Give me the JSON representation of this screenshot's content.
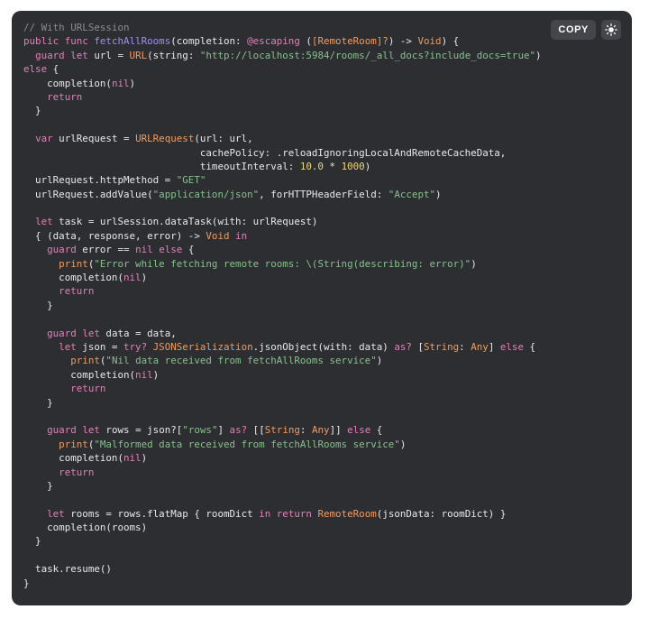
{
  "toolbar": {
    "copy_label": "COPY",
    "theme_icon": "sun-icon"
  },
  "colors": {
    "background": "#2d2e32",
    "comment": "#8a8c93",
    "keyword": "#e37fb8",
    "type": "#f29b5a",
    "function": "#9d8ef2",
    "string": "#86c08a",
    "number": "#ead675",
    "plain": "#e8e8ea"
  },
  "code": {
    "language": "swift",
    "lines": [
      [
        [
          "comment",
          "// With URLSession"
        ]
      ],
      [
        [
          "keyword",
          "public"
        ],
        [
          "plain",
          " "
        ],
        [
          "keyword",
          "func"
        ],
        [
          "plain",
          " "
        ],
        [
          "func",
          "fetchAllRooms"
        ],
        [
          "plain",
          "(completion: "
        ],
        [
          "keyword",
          "@escaping"
        ],
        [
          "plain",
          " ("
        ],
        [
          "type",
          "[RemoteRoom]?"
        ],
        [
          "plain",
          ") -> "
        ],
        [
          "type",
          "Void"
        ],
        [
          "plain",
          ") {"
        ]
      ],
      [
        [
          "plain",
          "  "
        ],
        [
          "keyword",
          "guard"
        ],
        [
          "plain",
          " "
        ],
        [
          "keyword",
          "let"
        ],
        [
          "plain",
          " url = "
        ],
        [
          "type",
          "URL"
        ],
        [
          "plain",
          "(string: "
        ],
        [
          "string",
          "\"http://localhost:5984/rooms/_all_docs?include_docs=true\""
        ],
        [
          "plain",
          ")"
        ]
      ],
      [
        [
          "keyword",
          "else"
        ],
        [
          "plain",
          " {"
        ]
      ],
      [
        [
          "plain",
          "    completion("
        ],
        [
          "keyword",
          "nil"
        ],
        [
          "plain",
          ")"
        ]
      ],
      [
        [
          "plain",
          "    "
        ],
        [
          "keyword",
          "return"
        ]
      ],
      [
        [
          "plain",
          "  }"
        ]
      ],
      [
        [
          "plain",
          ""
        ]
      ],
      [
        [
          "plain",
          "  "
        ],
        [
          "keyword",
          "var"
        ],
        [
          "plain",
          " urlRequest = "
        ],
        [
          "type",
          "URLRequest"
        ],
        [
          "plain",
          "(url: url,"
        ]
      ],
      [
        [
          "plain",
          "                              cachePolicy: .reloadIgnoringLocalAndRemoteCacheData,"
        ]
      ],
      [
        [
          "plain",
          "                              timeoutInterval: "
        ],
        [
          "number",
          "10.0"
        ],
        [
          "plain",
          " * "
        ],
        [
          "number",
          "1000"
        ],
        [
          "plain",
          ")"
        ]
      ],
      [
        [
          "plain",
          "  urlRequest.httpMethod = "
        ],
        [
          "string",
          "\"GET\""
        ]
      ],
      [
        [
          "plain",
          "  urlRequest.addValue("
        ],
        [
          "string",
          "\"application/json\""
        ],
        [
          "plain",
          ", forHTTPHeaderField: "
        ],
        [
          "string",
          "\"Accept\""
        ],
        [
          "plain",
          ")"
        ]
      ],
      [
        [
          "plain",
          ""
        ]
      ],
      [
        [
          "plain",
          "  "
        ],
        [
          "keyword",
          "let"
        ],
        [
          "plain",
          " task = urlSession.dataTask(with: urlRequest)"
        ]
      ],
      [
        [
          "plain",
          "  { (data, response, error) -> "
        ],
        [
          "type",
          "Void"
        ],
        [
          "plain",
          " "
        ],
        [
          "keyword",
          "in"
        ]
      ],
      [
        [
          "plain",
          "    "
        ],
        [
          "keyword",
          "guard"
        ],
        [
          "plain",
          " error == "
        ],
        [
          "keyword",
          "nil"
        ],
        [
          "plain",
          " "
        ],
        [
          "keyword",
          "else"
        ],
        [
          "plain",
          " {"
        ]
      ],
      [
        [
          "plain",
          "      "
        ],
        [
          "type",
          "print"
        ],
        [
          "plain",
          "("
        ],
        [
          "string",
          "\"Error while fetching remote rooms: \\(String(describing: error)\""
        ],
        [
          "plain",
          ")"
        ]
      ],
      [
        [
          "plain",
          "      completion("
        ],
        [
          "keyword",
          "nil"
        ],
        [
          "plain",
          ")"
        ]
      ],
      [
        [
          "plain",
          "      "
        ],
        [
          "keyword",
          "return"
        ]
      ],
      [
        [
          "plain",
          "    }"
        ]
      ],
      [
        [
          "plain",
          ""
        ]
      ],
      [
        [
          "plain",
          "    "
        ],
        [
          "keyword",
          "guard"
        ],
        [
          "plain",
          " "
        ],
        [
          "keyword",
          "let"
        ],
        [
          "plain",
          " data = data,"
        ]
      ],
      [
        [
          "plain",
          "      "
        ],
        [
          "keyword",
          "let"
        ],
        [
          "plain",
          " json = "
        ],
        [
          "keyword",
          "try?"
        ],
        [
          "plain",
          " "
        ],
        [
          "type",
          "JSONSerialization"
        ],
        [
          "plain",
          ".jsonObject(with: data) "
        ],
        [
          "keyword",
          "as?"
        ],
        [
          "plain",
          " ["
        ],
        [
          "type",
          "String"
        ],
        [
          "plain",
          ": "
        ],
        [
          "type",
          "Any"
        ],
        [
          "plain",
          "] "
        ],
        [
          "keyword",
          "else"
        ],
        [
          "plain",
          " {"
        ]
      ],
      [
        [
          "plain",
          "        "
        ],
        [
          "type",
          "print"
        ],
        [
          "plain",
          "("
        ],
        [
          "string",
          "\"Nil data received from fetchAllRooms service\""
        ],
        [
          "plain",
          ")"
        ]
      ],
      [
        [
          "plain",
          "        completion("
        ],
        [
          "keyword",
          "nil"
        ],
        [
          "plain",
          ")"
        ]
      ],
      [
        [
          "plain",
          "        "
        ],
        [
          "keyword",
          "return"
        ]
      ],
      [
        [
          "plain",
          "    }"
        ]
      ],
      [
        [
          "plain",
          ""
        ]
      ],
      [
        [
          "plain",
          "    "
        ],
        [
          "keyword",
          "guard"
        ],
        [
          "plain",
          " "
        ],
        [
          "keyword",
          "let"
        ],
        [
          "plain",
          " rows = json?["
        ],
        [
          "string",
          "\"rows\""
        ],
        [
          "plain",
          "] "
        ],
        [
          "keyword",
          "as?"
        ],
        [
          "plain",
          " [["
        ],
        [
          "type",
          "String"
        ],
        [
          "plain",
          ": "
        ],
        [
          "type",
          "Any"
        ],
        [
          "plain",
          "]] "
        ],
        [
          "keyword",
          "else"
        ],
        [
          "plain",
          " {"
        ]
      ],
      [
        [
          "plain",
          "      "
        ],
        [
          "type",
          "print"
        ],
        [
          "plain",
          "("
        ],
        [
          "string",
          "\"Malformed data received from fetchAllRooms service\""
        ],
        [
          "plain",
          ")"
        ]
      ],
      [
        [
          "plain",
          "      completion("
        ],
        [
          "keyword",
          "nil"
        ],
        [
          "plain",
          ")"
        ]
      ],
      [
        [
          "plain",
          "      "
        ],
        [
          "keyword",
          "return"
        ]
      ],
      [
        [
          "plain",
          "    }"
        ]
      ],
      [
        [
          "plain",
          ""
        ]
      ],
      [
        [
          "plain",
          "    "
        ],
        [
          "keyword",
          "let"
        ],
        [
          "plain",
          " rooms = rows.flatMap { roomDict "
        ],
        [
          "keyword",
          "in"
        ],
        [
          "plain",
          " "
        ],
        [
          "keyword",
          "return"
        ],
        [
          "plain",
          " "
        ],
        [
          "type",
          "RemoteRoom"
        ],
        [
          "plain",
          "(jsonData: roomDict) }"
        ]
      ],
      [
        [
          "plain",
          "    completion(rooms)"
        ]
      ],
      [
        [
          "plain",
          "  }"
        ]
      ],
      [
        [
          "plain",
          ""
        ]
      ],
      [
        [
          "plain",
          "  task.resume()"
        ]
      ],
      [
        [
          "plain",
          "}"
        ]
      ]
    ]
  }
}
